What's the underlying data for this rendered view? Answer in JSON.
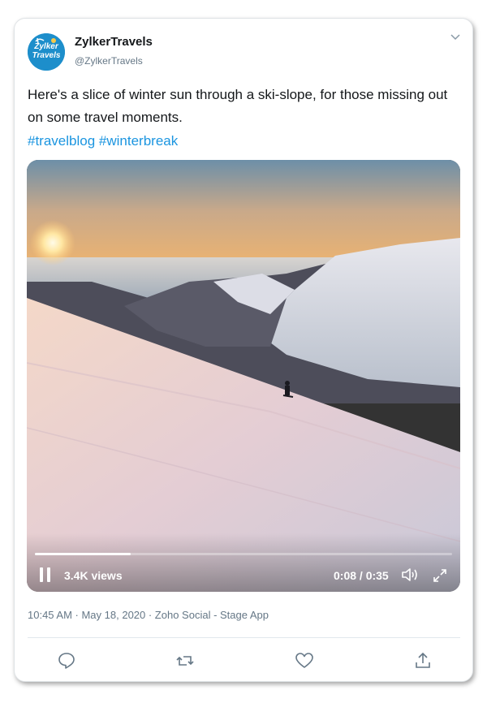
{
  "author": {
    "display_name": "ZylkerTravels",
    "handle": "@ZylkerTravels",
    "avatar_text": [
      "Zylker",
      "Travels"
    ]
  },
  "tweet": {
    "text": "Here's a slice of winter sun through a ski-slope, for those missing out on some travel moments.",
    "hashtags": [
      "#travelblog",
      "#winterbreak"
    ]
  },
  "video": {
    "views": "3.4K views",
    "time": "0:08 / 0:35",
    "progress": 0.23,
    "state": "playing"
  },
  "meta": {
    "timestamp": "10:45 AM · May 18, 2020 · Zoho Social - Stage App"
  },
  "actions": [
    "reply-icon",
    "retweet-icon",
    "like-icon",
    "share-icon"
  ],
  "colors": {
    "link": "#1b95e0",
    "secondary_text": "#657786",
    "avatar_bg": "#1d8ecb"
  }
}
